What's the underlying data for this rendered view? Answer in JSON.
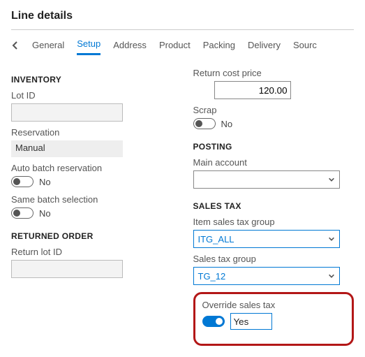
{
  "title": "Line details",
  "tabs": {
    "items": [
      "General",
      "Setup",
      "Address",
      "Product",
      "Packing",
      "Delivery",
      "Sourc"
    ],
    "active_index": 1
  },
  "left": {
    "inventory": {
      "heading": "INVENTORY",
      "lot_id_label": "Lot ID",
      "lot_id_value": "",
      "reservation_label": "Reservation",
      "reservation_value": "Manual",
      "auto_batch_label": "Auto batch reservation",
      "auto_batch_state": "No",
      "same_batch_label": "Same batch selection",
      "same_batch_state": "No"
    },
    "returned": {
      "heading": "RETURNED ORDER",
      "return_lot_label": "Return lot ID",
      "return_lot_value": ""
    }
  },
  "right": {
    "return_cost_label": "Return cost price",
    "return_cost_value": "120.00",
    "scrap_label": "Scrap",
    "scrap_state": "No",
    "posting": {
      "heading": "POSTING",
      "main_account_label": "Main account",
      "main_account_value": ""
    },
    "sales_tax": {
      "heading": "SALES TAX",
      "item_group_label": "Item sales tax group",
      "item_group_value": "ITG_ALL",
      "group_label": "Sales tax group",
      "group_value": "TG_12",
      "override_label": "Override sales tax",
      "override_state": "Yes"
    }
  }
}
